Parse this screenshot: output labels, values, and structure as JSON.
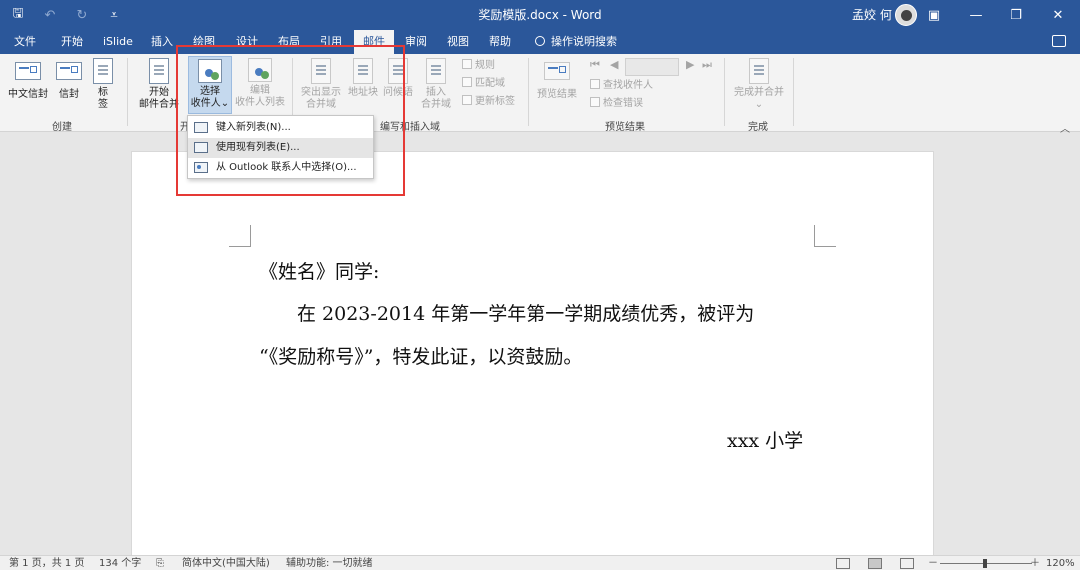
{
  "titlebar": {
    "doc_title": "奖励模版.docx - Word",
    "user": "孟姣 何",
    "qat": {
      "save": "🖫",
      "undo": "↶",
      "redo": "↻",
      "customize": "⩡"
    },
    "window": {
      "ribbon_options": "▣",
      "minimize": "—",
      "restore": "❐",
      "close": "✕"
    }
  },
  "tabs": [
    "文件",
    "开始",
    "iSlide",
    "插入",
    "绘图",
    "设计",
    "布局",
    "引用",
    "邮件",
    "审阅",
    "视图",
    "帮助"
  ],
  "active_tab": "邮件",
  "tell_me": "操作说明搜索",
  "ribbon": {
    "create": {
      "label": "创建",
      "chinese_envelope": "中文信封",
      "envelope": "信封",
      "labels_1": "标",
      "labels_2": "签"
    },
    "start": {
      "label_visible": "开",
      "start_merge_1": "开始",
      "start_merge_2": "邮件合并",
      "select_recipients_1": "选择",
      "select_recipients_2": "收件人",
      "edit_list_1": "编辑",
      "edit_list_2": "收件人列表",
      "caret": "⌄"
    },
    "write_insert": {
      "label": "编写和插入域",
      "highlight_1": "突出显示",
      "highlight_2": "合并域",
      "address_block": "地址块",
      "greeting_line": "问候语",
      "insert_field_1": "插入",
      "insert_field_2": "合并域",
      "rules": "规则",
      "match_fields": "匹配域",
      "update_labels": "更新标签"
    },
    "preview": {
      "label": "预览结果",
      "preview_results": "预览结果",
      "find_recipient": "查找收件人",
      "check_errors": "检查错误",
      "first": "⏮",
      "prev": "◀",
      "next": "▶",
      "last": "⏭"
    },
    "finish": {
      "label": "完成",
      "finish_merge_1": "完成并合并",
      "caret": "⌄"
    },
    "collapse": "︿"
  },
  "dropdown": {
    "items": [
      "键入新列表(N)...",
      "使用现有列表(E)...",
      "从 Outlook 联系人中选择(O)..."
    ],
    "hovered_index": 1
  },
  "document": {
    "line1": "《姓名》同学:",
    "line2": "在 2023-2014 年第一学年第一学期成绩优秀，被评为",
    "line3": "“《奖励称号》”，特发此证，以资鼓励。",
    "signature": "xxx 小学"
  },
  "statusbar": {
    "page": "第 1 页，共 1 页",
    "words": "134 个字",
    "language": "简体中文(中国大陆)",
    "accessibility": "辅助功能: 一切就绪",
    "zoom_minus": "－",
    "zoom_plus": "＋",
    "zoom": "120%"
  },
  "colors": {
    "title_bar": "#2b579a",
    "highlight_box": "#e53935",
    "ribbon_bg": "#f3f3f3"
  }
}
